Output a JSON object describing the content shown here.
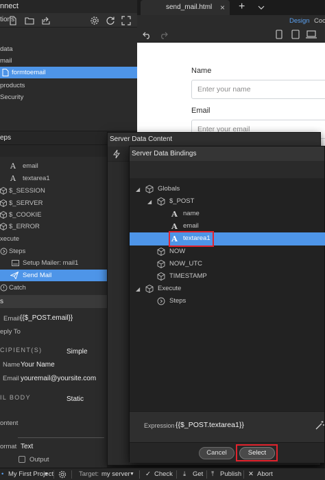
{
  "left_panel": {
    "title": "nnect",
    "actions_label": "tions",
    "tree": [
      {
        "label": "data",
        "selected": false
      },
      {
        "label": "mail",
        "selected": false
      },
      {
        "label": "formtoemail",
        "selected": true
      },
      {
        "label": "products",
        "selected": false
      },
      {
        "label": "Security",
        "selected": false
      }
    ]
  },
  "document": {
    "tab_title": "send_mail.html",
    "tab_close": "×",
    "new_tab": "+",
    "view_design": "Design",
    "view_code": "Coc",
    "form": {
      "name_label": "Name",
      "name_placeholder": "Enter your name",
      "email_label": "Email",
      "email_placeholder": "Enter your email"
    }
  },
  "steps_panel": {
    "title": "eps",
    "rows": [
      {
        "label": "email",
        "indent": "var",
        "selected": false
      },
      {
        "label": "textarea1",
        "indent": "var",
        "selected": false
      },
      {
        "label": "$_SESSION",
        "indent": "cube",
        "selected": false
      },
      {
        "label": "$_SERVER",
        "indent": "cube",
        "selected": false
      },
      {
        "label": "$_COOKIE",
        "indent": "cube",
        "selected": false
      },
      {
        "label": "$_ERROR",
        "indent": "cube",
        "selected": false
      },
      {
        "label": "xecute",
        "indent": "none",
        "selected": false
      },
      {
        "label": "Steps",
        "indent": "steps",
        "selected": false
      },
      {
        "label": "Setup Mailer: mail1",
        "indent": "mailer",
        "selected": false
      },
      {
        "label": "Send Mail",
        "indent": "send",
        "selected": true
      },
      {
        "label": "Catch",
        "indent": "catch",
        "selected": false
      }
    ],
    "props_header": "s",
    "props": {
      "email_label": "Email",
      "email_value": "{{$_POST.email}}",
      "reply_label": "eply To",
      "recipients_caption": "CIPIENT(S)",
      "recipients_mode": "Simple",
      "rname_label": "Name",
      "rname_value": "Your Name",
      "remail_label": "Email",
      "remail_value": "youremail@yoursite.com",
      "body_caption": "IL BODY",
      "body_mode": "Static",
      "content_label": "ontent",
      "format_label": "ormat",
      "format_value": "Text",
      "output_label": "Output"
    }
  },
  "server_data_content": {
    "title": "Server Data Content"
  },
  "server_data_bindings": {
    "title": "Server Data Bindings",
    "tree": [
      {
        "label": "Globals",
        "type": "cube",
        "level": 0,
        "expanded": true,
        "selected": false
      },
      {
        "label": "$_POST",
        "type": "cube",
        "level": 1,
        "expanded": true,
        "selected": false
      },
      {
        "label": "name",
        "type": "text",
        "level": 2,
        "selected": false
      },
      {
        "label": "email",
        "type": "text",
        "level": 2,
        "selected": false
      },
      {
        "label": "textarea1",
        "type": "text",
        "level": 2,
        "selected": true
      },
      {
        "label": "NOW",
        "type": "cube",
        "level": 1,
        "selected": false
      },
      {
        "label": "NOW_UTC",
        "type": "cube",
        "level": 1,
        "selected": false
      },
      {
        "label": "TIMESTAMP",
        "type": "cube",
        "level": 1,
        "selected": false
      },
      {
        "label": "Execute",
        "type": "cube",
        "level": 0,
        "expanded": true,
        "selected": false
      },
      {
        "label": "Steps",
        "type": "steps",
        "level": 1,
        "selected": false
      }
    ],
    "expression_label": "Expression",
    "expression_value": "{{$_POST.textarea1}}",
    "cancel_label": "Cancel",
    "select_label": "Select"
  },
  "statusbar": {
    "project": "My First Project",
    "target_label": "Target:",
    "target_value": "my server",
    "check": "Check",
    "get": "Get",
    "publish": "Publish",
    "abort": "Abort"
  },
  "colors": {
    "selection": "#4e95e8",
    "highlight_box": "#e2232d",
    "accent_link": "#5aa0f0"
  }
}
